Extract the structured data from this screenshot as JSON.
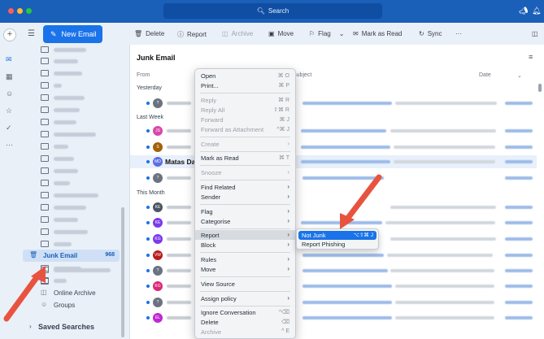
{
  "titlebar": {
    "search_label": "Search"
  },
  "toolbar": {
    "new_email": "New Email",
    "delete": "Delete",
    "report": "Report",
    "archive": "Archive",
    "move": "Move",
    "flag": "Flag",
    "mark_as_read": "Mark as Read",
    "sync": "Sync",
    "more": "···"
  },
  "folders": {
    "junk_label": "Junk Email",
    "junk_count": "968",
    "online_archive": "Online Archive",
    "groups": "Groups",
    "saved_searches": "Saved Searches"
  },
  "maillist": {
    "title": "Junk Email",
    "col_from": "From",
    "col_subject": "Subject",
    "col_date": "Date",
    "group_yesterday": "Yesterday",
    "group_last_week": "Last Week",
    "group_this_month": "This Month",
    "highlight_sender": "Matas Da",
    "avatars": [
      "?",
      "JS",
      "S",
      "MD",
      "?",
      "KE",
      "KE",
      "KG",
      "VW",
      "?",
      "KG",
      "?",
      "EL"
    ],
    "avatar_colors": [
      "#6b7280",
      "#d946a8",
      "#a16207",
      "#5b6ee1",
      "#6b7280",
      "#4b5563",
      "#7c3aed",
      "#7c3aed",
      "#b91c1c",
      "#6b7280",
      "#db2777",
      "#6b7280",
      "#c026d3"
    ]
  },
  "context_menu": {
    "open": "Open",
    "open_sc": "⌘ O",
    "print": "Print...",
    "print_sc": "⌘ P",
    "reply": "Reply",
    "reply_sc": "⌘ R",
    "reply_all": "Reply All",
    "reply_all_sc": "⇧⌘ R",
    "forward": "Forward",
    "forward_sc": "⌘ J",
    "forward_attachment": "Forward as Attachment",
    "forward_attachment_sc": "^⌘ J",
    "create": "Create",
    "mark_as_read": "Mark as Read",
    "mark_as_read_sc": "⌘ T",
    "snooze": "Snooze",
    "find_related": "Find Related",
    "sender": "Sender",
    "flag": "Flag",
    "categorise": "Categorise",
    "report": "Report",
    "block": "Block",
    "rules": "Rules",
    "move": "Move",
    "view_source": "View Source",
    "assign_policy": "Assign policy",
    "ignore_conversation": "Ignore Conversation",
    "ignore_conversation_sc": "^⌫",
    "delete": "Delete",
    "delete_sc": "⌫",
    "archive": "Archive",
    "archive_sc": "^ E"
  },
  "submenu": {
    "not_junk": "Not Junk",
    "not_junk_sc": "⌥⇧⌘ J",
    "report_phishing": "Report Phishing"
  }
}
